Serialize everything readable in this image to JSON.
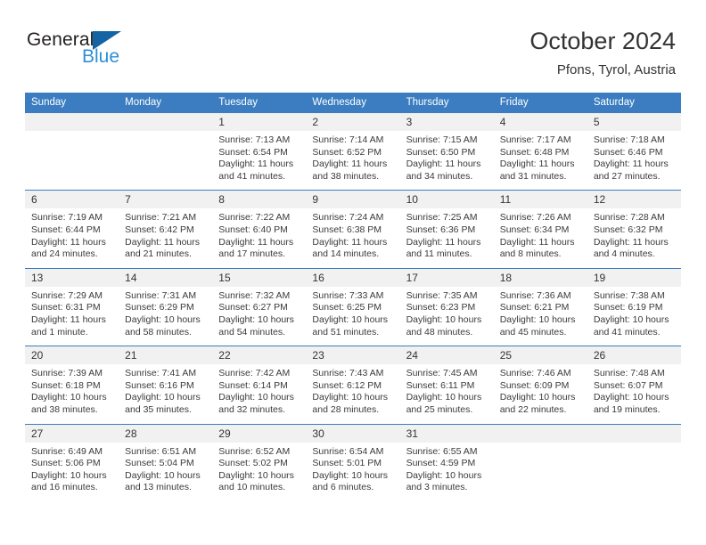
{
  "brand": {
    "name_line1": "General",
    "name_line2": "Blue",
    "logo_icon": "triangle-icon",
    "color_dark": "#231f20",
    "color_blue": "#2e8fd8",
    "color_triangle": "#1464a5"
  },
  "header": {
    "title": "October 2024",
    "subtitle": "Pfons, Tyrol, Austria"
  },
  "theme": {
    "header_bar": "#3b7dc0",
    "daynum_band": "#f1f1f1",
    "text": "#333333"
  },
  "weekdays": [
    "Sunday",
    "Monday",
    "Tuesday",
    "Wednesday",
    "Thursday",
    "Friday",
    "Saturday"
  ],
  "labels": {
    "sunrise_prefix": "Sunrise:",
    "sunset_prefix": "Sunset:",
    "daylight_prefix": "Daylight:"
  },
  "weeks": [
    {
      "days": [
        {
          "num": "",
          "l1": "",
          "l2": "",
          "l3": "",
          "l4": ""
        },
        {
          "num": "",
          "l1": "",
          "l2": "",
          "l3": "",
          "l4": ""
        },
        {
          "num": "1",
          "l1": "Sunrise: 7:13 AM",
          "l2": "Sunset: 6:54 PM",
          "l3": "Daylight: 11 hours",
          "l4": "and 41 minutes."
        },
        {
          "num": "2",
          "l1": "Sunrise: 7:14 AM",
          "l2": "Sunset: 6:52 PM",
          "l3": "Daylight: 11 hours",
          "l4": "and 38 minutes."
        },
        {
          "num": "3",
          "l1": "Sunrise: 7:15 AM",
          "l2": "Sunset: 6:50 PM",
          "l3": "Daylight: 11 hours",
          "l4": "and 34 minutes."
        },
        {
          "num": "4",
          "l1": "Sunrise: 7:17 AM",
          "l2": "Sunset: 6:48 PM",
          "l3": "Daylight: 11 hours",
          "l4": "and 31 minutes."
        },
        {
          "num": "5",
          "l1": "Sunrise: 7:18 AM",
          "l2": "Sunset: 6:46 PM",
          "l3": "Daylight: 11 hours",
          "l4": "and 27 minutes."
        }
      ]
    },
    {
      "days": [
        {
          "num": "6",
          "l1": "Sunrise: 7:19 AM",
          "l2": "Sunset: 6:44 PM",
          "l3": "Daylight: 11 hours",
          "l4": "and 24 minutes."
        },
        {
          "num": "7",
          "l1": "Sunrise: 7:21 AM",
          "l2": "Sunset: 6:42 PM",
          "l3": "Daylight: 11 hours",
          "l4": "and 21 minutes."
        },
        {
          "num": "8",
          "l1": "Sunrise: 7:22 AM",
          "l2": "Sunset: 6:40 PM",
          "l3": "Daylight: 11 hours",
          "l4": "and 17 minutes."
        },
        {
          "num": "9",
          "l1": "Sunrise: 7:24 AM",
          "l2": "Sunset: 6:38 PM",
          "l3": "Daylight: 11 hours",
          "l4": "and 14 minutes."
        },
        {
          "num": "10",
          "l1": "Sunrise: 7:25 AM",
          "l2": "Sunset: 6:36 PM",
          "l3": "Daylight: 11 hours",
          "l4": "and 11 minutes."
        },
        {
          "num": "11",
          "l1": "Sunrise: 7:26 AM",
          "l2": "Sunset: 6:34 PM",
          "l3": "Daylight: 11 hours",
          "l4": "and 8 minutes."
        },
        {
          "num": "12",
          "l1": "Sunrise: 7:28 AM",
          "l2": "Sunset: 6:32 PM",
          "l3": "Daylight: 11 hours",
          "l4": "and 4 minutes."
        }
      ]
    },
    {
      "days": [
        {
          "num": "13",
          "l1": "Sunrise: 7:29 AM",
          "l2": "Sunset: 6:31 PM",
          "l3": "Daylight: 11 hours",
          "l4": "and 1 minute."
        },
        {
          "num": "14",
          "l1": "Sunrise: 7:31 AM",
          "l2": "Sunset: 6:29 PM",
          "l3": "Daylight: 10 hours",
          "l4": "and 58 minutes."
        },
        {
          "num": "15",
          "l1": "Sunrise: 7:32 AM",
          "l2": "Sunset: 6:27 PM",
          "l3": "Daylight: 10 hours",
          "l4": "and 54 minutes."
        },
        {
          "num": "16",
          "l1": "Sunrise: 7:33 AM",
          "l2": "Sunset: 6:25 PM",
          "l3": "Daylight: 10 hours",
          "l4": "and 51 minutes."
        },
        {
          "num": "17",
          "l1": "Sunrise: 7:35 AM",
          "l2": "Sunset: 6:23 PM",
          "l3": "Daylight: 10 hours",
          "l4": "and 48 minutes."
        },
        {
          "num": "18",
          "l1": "Sunrise: 7:36 AM",
          "l2": "Sunset: 6:21 PM",
          "l3": "Daylight: 10 hours",
          "l4": "and 45 minutes."
        },
        {
          "num": "19",
          "l1": "Sunrise: 7:38 AM",
          "l2": "Sunset: 6:19 PM",
          "l3": "Daylight: 10 hours",
          "l4": "and 41 minutes."
        }
      ]
    },
    {
      "days": [
        {
          "num": "20",
          "l1": "Sunrise: 7:39 AM",
          "l2": "Sunset: 6:18 PM",
          "l3": "Daylight: 10 hours",
          "l4": "and 38 minutes."
        },
        {
          "num": "21",
          "l1": "Sunrise: 7:41 AM",
          "l2": "Sunset: 6:16 PM",
          "l3": "Daylight: 10 hours",
          "l4": "and 35 minutes."
        },
        {
          "num": "22",
          "l1": "Sunrise: 7:42 AM",
          "l2": "Sunset: 6:14 PM",
          "l3": "Daylight: 10 hours",
          "l4": "and 32 minutes."
        },
        {
          "num": "23",
          "l1": "Sunrise: 7:43 AM",
          "l2": "Sunset: 6:12 PM",
          "l3": "Daylight: 10 hours",
          "l4": "and 28 minutes."
        },
        {
          "num": "24",
          "l1": "Sunrise: 7:45 AM",
          "l2": "Sunset: 6:11 PM",
          "l3": "Daylight: 10 hours",
          "l4": "and 25 minutes."
        },
        {
          "num": "25",
          "l1": "Sunrise: 7:46 AM",
          "l2": "Sunset: 6:09 PM",
          "l3": "Daylight: 10 hours",
          "l4": "and 22 minutes."
        },
        {
          "num": "26",
          "l1": "Sunrise: 7:48 AM",
          "l2": "Sunset: 6:07 PM",
          "l3": "Daylight: 10 hours",
          "l4": "and 19 minutes."
        }
      ]
    },
    {
      "days": [
        {
          "num": "27",
          "l1": "Sunrise: 6:49 AM",
          "l2": "Sunset: 5:06 PM",
          "l3": "Daylight: 10 hours",
          "l4": "and 16 minutes."
        },
        {
          "num": "28",
          "l1": "Sunrise: 6:51 AM",
          "l2": "Sunset: 5:04 PM",
          "l3": "Daylight: 10 hours",
          "l4": "and 13 minutes."
        },
        {
          "num": "29",
          "l1": "Sunrise: 6:52 AM",
          "l2": "Sunset: 5:02 PM",
          "l3": "Daylight: 10 hours",
          "l4": "and 10 minutes."
        },
        {
          "num": "30",
          "l1": "Sunrise: 6:54 AM",
          "l2": "Sunset: 5:01 PM",
          "l3": "Daylight: 10 hours",
          "l4": "and 6 minutes."
        },
        {
          "num": "31",
          "l1": "Sunrise: 6:55 AM",
          "l2": "Sunset: 4:59 PM",
          "l3": "Daylight: 10 hours",
          "l4": "and 3 minutes."
        },
        {
          "num": "",
          "l1": "",
          "l2": "",
          "l3": "",
          "l4": ""
        },
        {
          "num": "",
          "l1": "",
          "l2": "",
          "l3": "",
          "l4": ""
        }
      ]
    }
  ]
}
